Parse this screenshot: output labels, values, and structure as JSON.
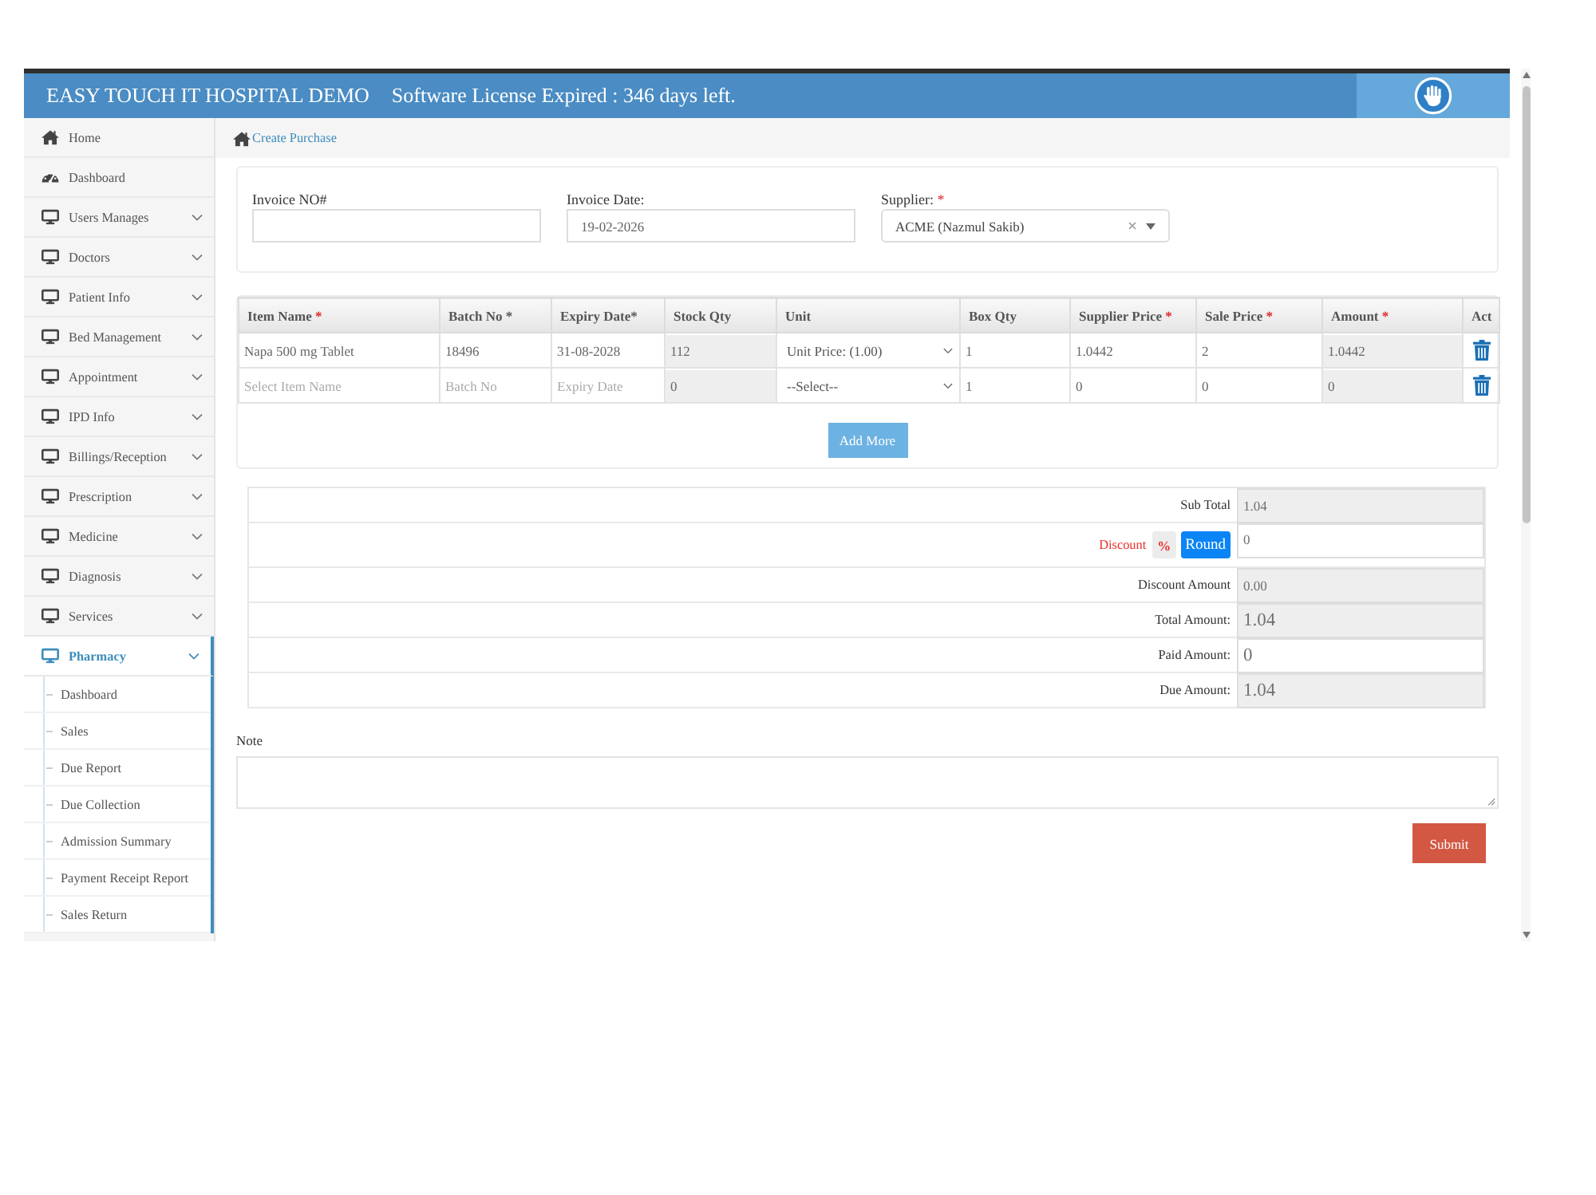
{
  "header": {
    "title": "EASY TOUCH IT HOSPITAL DEMO",
    "notice": "Software License Expired : 346 days left."
  },
  "sidebar": {
    "items": [
      {
        "label": "Home",
        "kind": "link",
        "selected": false
      },
      {
        "label": "Dashboard",
        "kind": "link",
        "selected": false
      },
      {
        "label": "Users Manages",
        "kind": "menu",
        "selected": false
      },
      {
        "label": "Doctors",
        "kind": "menu",
        "selected": false
      },
      {
        "label": "Patient Info",
        "kind": "menu",
        "selected": false
      },
      {
        "label": "Bed Management",
        "kind": "menu",
        "selected": false
      },
      {
        "label": "Appointment",
        "kind": "menu",
        "selected": false
      },
      {
        "label": "IPD Info",
        "kind": "menu",
        "selected": false
      },
      {
        "label": "Billings/Reception",
        "kind": "menu",
        "selected": false
      },
      {
        "label": "Prescription",
        "kind": "menu",
        "selected": false
      },
      {
        "label": "Medicine",
        "kind": "menu",
        "selected": false
      },
      {
        "label": "Diagnosis",
        "kind": "menu",
        "selected": false
      },
      {
        "label": "Services",
        "kind": "menu",
        "selected": false
      },
      {
        "label": "Pharmacy",
        "kind": "menu",
        "selected": true,
        "children": [
          {
            "label": "Dashboard",
            "selected": false
          },
          {
            "label": "Sales",
            "selected": false
          },
          {
            "label": "Due Report",
            "selected": false
          },
          {
            "label": "Due Collection",
            "selected": false
          },
          {
            "label": "Admission Summary",
            "selected": false
          },
          {
            "label": "Payment Receipt Report",
            "selected": false
          },
          {
            "label": "Sales Return",
            "selected": false
          }
        ]
      }
    ]
  },
  "breadcrumb": {
    "label": "Create Purchase"
  },
  "invoice": {
    "fields": [
      {
        "label": "Invoice NO#",
        "kind": "text"
      },
      {
        "label": "Invoice Date:",
        "kind": "date",
        "value": "19-02-2026"
      },
      {
        "label": "Supplier:",
        "required_mark": "*",
        "kind": "select",
        "value": "ACME (Nazmul Sakib)"
      }
    ]
  },
  "items_table": {
    "columns": [
      {
        "label": "Item Name",
        "required_mark": "*"
      },
      {
        "label": "Batch No *"
      },
      {
        "label": "Expiry Date*"
      },
      {
        "label": "Stock Qty"
      },
      {
        "label": "Unit"
      },
      {
        "label": "Box Qty"
      },
      {
        "label": "Supplier Price",
        "required_mark": "*"
      },
      {
        "label": "Sale Price",
        "required_mark": "*"
      },
      {
        "label": "Amount",
        "required_mark": "*"
      },
      {
        "label": "Act"
      }
    ],
    "rows": [
      {
        "cells": [
          {
            "kind": "input",
            "value": "Napa 500 mg Tablet"
          },
          {
            "kind": "input",
            "value": "18496"
          },
          {
            "kind": "input",
            "value": "31-08-2028"
          },
          {
            "kind": "readonly",
            "value": "112"
          },
          {
            "kind": "select",
            "value": "Unit Price: (1.00)"
          },
          {
            "kind": "input",
            "value": "1"
          },
          {
            "kind": "input",
            "value": "1.0442"
          },
          {
            "kind": "input",
            "value": "2"
          },
          {
            "kind": "readonly",
            "value": "1.0442"
          }
        ]
      },
      {
        "cells": [
          {
            "kind": "input",
            "placeholder": "Select Item Name"
          },
          {
            "kind": "input",
            "placeholder": "Batch No"
          },
          {
            "kind": "input",
            "placeholder": "Expiry Date"
          },
          {
            "kind": "readonly",
            "value": "0"
          },
          {
            "kind": "select",
            "value": "--Select--"
          },
          {
            "kind": "input",
            "value": "1"
          },
          {
            "kind": "input",
            "value": "0"
          },
          {
            "kind": "input",
            "value": "0"
          },
          {
            "kind": "readonly",
            "value": "0"
          }
        ]
      }
    ],
    "add_button": "Add More"
  },
  "totals": {
    "rows": [
      {
        "kind": "detail",
        "label": "Sub Total",
        "value": "1.04",
        "readonly": true
      },
      {
        "kind": "discount",
        "label": "Discount",
        "buttons": [
          {
            "label": "%",
            "kind": "default"
          },
          {
            "label": "Round",
            "kind": "primary"
          }
        ],
        "value": "0",
        "readonly": false
      },
      {
        "kind": "detail",
        "label": "Discount Amount",
        "value": "0.00",
        "readonly": true
      },
      {
        "kind": "amount",
        "label": "Total Amount:",
        "value": "1.04",
        "readonly": true
      },
      {
        "kind": "amount",
        "label": "Paid Amount:",
        "value": "0",
        "readonly": false
      },
      {
        "kind": "amount",
        "label": "Due Amount:",
        "value": "1.04",
        "readonly": true
      }
    ]
  },
  "note": {
    "label": "Note"
  },
  "submit_button": "Submit"
}
